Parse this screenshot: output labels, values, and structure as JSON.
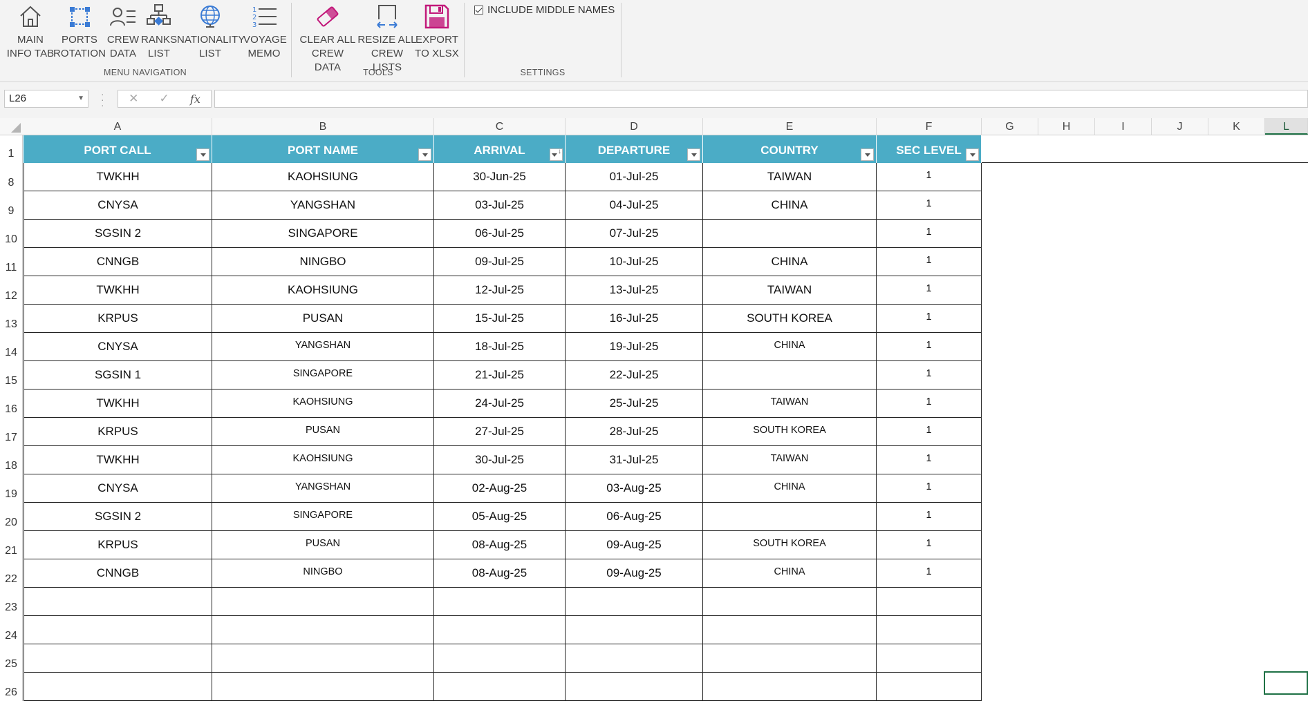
{
  "ribbon": {
    "buttons": [
      {
        "id": "main-info-tab",
        "label": "MAIN\nINFO TAB",
        "icon": "home-icon"
      },
      {
        "id": "ports-rotation",
        "label": "PORTS\nROTATION",
        "icon": "rotation-icon"
      },
      {
        "id": "crew-data",
        "label": "CREW\nDATA",
        "icon": "crew-list-icon"
      },
      {
        "id": "ranks-list",
        "label": "RANKS\nLIST",
        "icon": "hierarchy-icon"
      },
      {
        "id": "nationality-list",
        "label": "NATIONALITY\nLIST",
        "icon": "globe-icon"
      },
      {
        "id": "voyage-memo",
        "label": "VOYAGE\nMEMO",
        "icon": "numbered-list-icon"
      },
      {
        "id": "clear-all-crew-data",
        "label": "CLEAR ALL\nCREW DATA",
        "icon": "eraser-icon"
      },
      {
        "id": "resize-all-crew-lists",
        "label": "RESIZE ALL\nCREW LISTS",
        "icon": "resize-icon"
      },
      {
        "id": "export-to-xlsx",
        "label": "EXPORT\nTO XLSX",
        "icon": "save-icon"
      }
    ],
    "groups": {
      "menu_navigation": "MENU NAVIGATION",
      "tools": "TOOLS",
      "settings": "SETTINGS"
    },
    "settings": {
      "include_middle_names_label": "INCLUDE MIDDLE NAMES",
      "include_middle_names_checked": true
    },
    "colors": {
      "icon_blue": "#3a7bd5",
      "icon_magenta": "#c2187a",
      "icon_gray": "#555555"
    }
  },
  "formula_bar": {
    "name_box": "L26",
    "formula": ""
  },
  "grid": {
    "column_letters": [
      "A",
      "B",
      "C",
      "D",
      "E",
      "F",
      "G",
      "H",
      "I",
      "J",
      "K",
      "L"
    ],
    "active_column": "L",
    "header_row_number": "1",
    "headers": [
      "PORT CALL",
      "PORT NAME",
      "ARRIVAL",
      "DEPARTURE",
      "COUNTRY",
      "SEC LEVEL"
    ],
    "sorted_column": "ARRIVAL",
    "header_color": "#4bacc6",
    "rows": [
      {
        "num": "8",
        "cells": [
          "TWKHH",
          "KAOHSIUNG",
          "30-Jun-25",
          "01-Jul-25",
          "TAIWAN",
          "1"
        ],
        "size": "big"
      },
      {
        "num": "9",
        "cells": [
          "CNYSA",
          "YANGSHAN",
          "03-Jul-25",
          "04-Jul-25",
          "CHINA",
          "1"
        ],
        "size": "big"
      },
      {
        "num": "10",
        "cells": [
          "SGSIN 2",
          "SINGAPORE",
          "06-Jul-25",
          "07-Jul-25",
          "",
          "1"
        ],
        "size": "big"
      },
      {
        "num": "11",
        "cells": [
          "CNNGB",
          "NINGBO",
          "09-Jul-25",
          "10-Jul-25",
          "CHINA",
          "1"
        ],
        "size": "big"
      },
      {
        "num": "12",
        "cells": [
          "TWKHH",
          "KAOHSIUNG",
          "12-Jul-25",
          "13-Jul-25",
          "TAIWAN",
          "1"
        ],
        "size": "big"
      },
      {
        "num": "13",
        "cells": [
          "KRPUS",
          "PUSAN",
          "15-Jul-25",
          "16-Jul-25",
          "SOUTH KOREA",
          "1"
        ],
        "size": "big"
      },
      {
        "num": "14",
        "cells": [
          "CNYSA",
          "YANGSHAN",
          "18-Jul-25",
          "19-Jul-25",
          "CHINA",
          "1"
        ],
        "size": "small"
      },
      {
        "num": "15",
        "cells": [
          "SGSIN 1",
          "SINGAPORE",
          "21-Jul-25",
          "22-Jul-25",
          "",
          "1"
        ],
        "size": "small"
      },
      {
        "num": "16",
        "cells": [
          "TWKHH",
          "KAOHSIUNG",
          "24-Jul-25",
          "25-Jul-25",
          "TAIWAN",
          "1"
        ],
        "size": "small"
      },
      {
        "num": "17",
        "cells": [
          "KRPUS",
          "PUSAN",
          "27-Jul-25",
          "28-Jul-25",
          "SOUTH KOREA",
          "1"
        ],
        "size": "small"
      },
      {
        "num": "18",
        "cells": [
          "TWKHH",
          "KAOHSIUNG",
          "30-Jul-25",
          "31-Jul-25",
          "TAIWAN",
          "1"
        ],
        "size": "small"
      },
      {
        "num": "19",
        "cells": [
          "CNYSA",
          "YANGSHAN",
          "02-Aug-25",
          "03-Aug-25",
          "CHINA",
          "1"
        ],
        "size": "small"
      },
      {
        "num": "20",
        "cells": [
          "SGSIN 2",
          "SINGAPORE",
          "05-Aug-25",
          "06-Aug-25",
          "",
          "1"
        ],
        "size": "small"
      },
      {
        "num": "21",
        "cells": [
          "KRPUS",
          "PUSAN",
          "08-Aug-25",
          "09-Aug-25",
          "SOUTH KOREA",
          "1"
        ],
        "size": "small"
      },
      {
        "num": "22",
        "cells": [
          "CNNGB",
          "NINGBO",
          "08-Aug-25",
          "09-Aug-25",
          "CHINA",
          "1"
        ],
        "size": "small"
      },
      {
        "num": "23",
        "cells": [
          "",
          "",
          "",
          "",
          "",
          ""
        ],
        "size": "small"
      },
      {
        "num": "24",
        "cells": [
          "",
          "",
          "",
          "",
          "",
          ""
        ],
        "size": "small"
      },
      {
        "num": "25",
        "cells": [
          "",
          "",
          "",
          "",
          "",
          ""
        ],
        "size": "small"
      },
      {
        "num": "26",
        "cells": [
          "",
          "",
          "",
          "",
          "",
          ""
        ],
        "size": "small"
      }
    ]
  }
}
